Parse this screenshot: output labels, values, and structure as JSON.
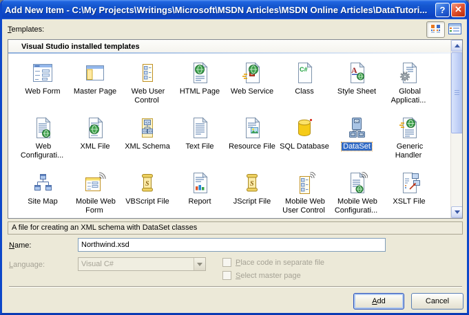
{
  "window": {
    "title": "Add New Item - C:\\My Projects\\Writings\\Microsoft\\MSDN Articles\\MSDN Online Articles\\DataTutori...",
    "help_glyph": "?",
    "close_glyph": "✕"
  },
  "templates": {
    "label": "Templates:",
    "group_header": "Visual Studio installed templates",
    "view_buttons": [
      {
        "icon": "large-icons-view-icon",
        "selected": true
      },
      {
        "icon": "details-view-icon",
        "selected": false
      }
    ],
    "items": [
      {
        "label": "Web Form",
        "icon": "web-form"
      },
      {
        "label": "Master Page",
        "icon": "master-page"
      },
      {
        "label": "Web User Control",
        "icon": "web-user-control"
      },
      {
        "label": "HTML Page",
        "icon": "html-page"
      },
      {
        "label": "Web Service",
        "icon": "web-service"
      },
      {
        "label": "Class",
        "icon": "class"
      },
      {
        "label": "Style Sheet",
        "icon": "style-sheet"
      },
      {
        "label": "Global Applicati...",
        "icon": "global-application"
      },
      {
        "label": "Web Configurati...",
        "icon": "web-config"
      },
      {
        "label": "XML File",
        "icon": "xml-file"
      },
      {
        "label": "XML Schema",
        "icon": "xml-schema"
      },
      {
        "label": "Text File",
        "icon": "text-file"
      },
      {
        "label": "Resource File",
        "icon": "resource-file"
      },
      {
        "label": "SQL Database",
        "icon": "sql-database"
      },
      {
        "label": "DataSet",
        "icon": "dataset",
        "selected": true
      },
      {
        "label": "Generic Handler",
        "icon": "generic-handler"
      },
      {
        "label": "Site Map",
        "icon": "site-map"
      },
      {
        "label": "Mobile Web Form",
        "icon": "mobile-web-form"
      },
      {
        "label": "VBScript File",
        "icon": "vbscript-file"
      },
      {
        "label": "Report",
        "icon": "report"
      },
      {
        "label": "JScript File",
        "icon": "jscript-file"
      },
      {
        "label": "Mobile Web User Control",
        "icon": "mobile-web-user-control"
      },
      {
        "label": "Mobile Web Configurati...",
        "icon": "mobile-web-config"
      },
      {
        "label": "XSLT File",
        "icon": "xslt-file"
      }
    ]
  },
  "description": "A file for creating an XML schema with DataSet classes",
  "fields": {
    "name_label": "Name:",
    "name_value": "Northwind.xsd",
    "language_label": "Language:",
    "language_value": "Visual C#",
    "checkbox_separate_file": "Place code in separate file",
    "checkbox_master_page": "Select master page"
  },
  "buttons": {
    "add": "Add",
    "cancel": "Cancel"
  },
  "colors": {
    "selection": "#316AC5",
    "titlebar": "#1C5BD8",
    "dialog_bg": "#ECE9D8",
    "close_button": "#D8431B"
  }
}
